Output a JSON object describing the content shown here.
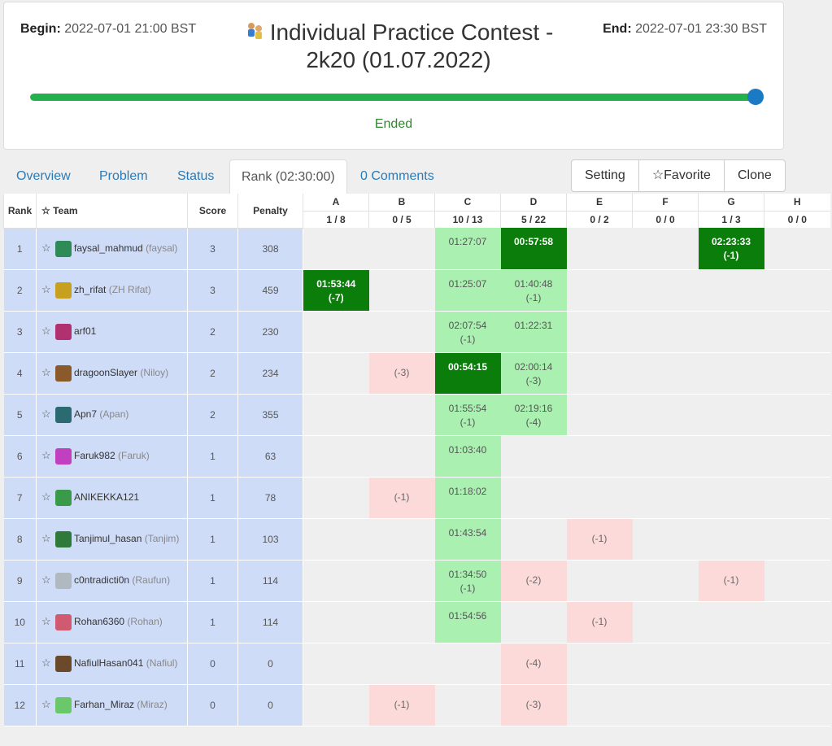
{
  "header": {
    "begin_label": "Begin:",
    "begin_value": "2022-07-01 21:00 BST",
    "end_label": "End:",
    "end_value": "2022-07-01 23:30 BST",
    "title": "Individual Practice Contest - 2k20 (01.07.2022)",
    "progress": 1.0,
    "status": "Ended"
  },
  "tabs": [
    {
      "label": "Overview"
    },
    {
      "label": "Problem"
    },
    {
      "label": "Status"
    },
    {
      "label": "Rank (02:30:00)"
    },
    {
      "label": "0 Comments"
    }
  ],
  "buttons": [
    {
      "label": "Setting"
    },
    {
      "label": "☆Favorite"
    },
    {
      "label": "Clone"
    }
  ],
  "table": {
    "col_rank": "Rank",
    "col_team": "☆ Team",
    "col_score": "Score",
    "col_penalty": "Penalty",
    "problems": [
      {
        "id": "A",
        "stat": "1 / 8"
      },
      {
        "id": "B",
        "stat": "0 / 5"
      },
      {
        "id": "C",
        "stat": "10 / 13"
      },
      {
        "id": "D",
        "stat": "5 / 22"
      },
      {
        "id": "E",
        "stat": "0 / 2"
      },
      {
        "id": "F",
        "stat": "0 / 0"
      },
      {
        "id": "G",
        "stat": "1 / 3"
      },
      {
        "id": "H",
        "stat": "0 / 0"
      }
    ],
    "rows": [
      {
        "rank": "1",
        "team": "faysal_mahmud",
        "nick": "(faysal)",
        "score": "3",
        "penalty": "308",
        "avatar_color": "#2e8b57",
        "cells": [
          {
            "s": "empty"
          },
          {
            "s": "empty"
          },
          {
            "s": "solved",
            "time": "01:27:07",
            "pen": ""
          },
          {
            "s": "first",
            "time": "00:57:58",
            "pen": ""
          },
          {
            "s": "empty"
          },
          {
            "s": "empty"
          },
          {
            "s": "first",
            "time": "02:23:33",
            "pen": "(-1)"
          },
          {
            "s": "empty"
          }
        ]
      },
      {
        "rank": "2",
        "team": "zh_rifat",
        "nick": "(ZH Rifat)",
        "score": "3",
        "penalty": "459",
        "avatar_color": "#c8a020",
        "cells": [
          {
            "s": "first",
            "time": "01:53:44",
            "pen": "(-7)"
          },
          {
            "s": "empty"
          },
          {
            "s": "solved",
            "time": "01:25:07",
            "pen": ""
          },
          {
            "s": "solved",
            "time": "01:40:48",
            "pen": "(-1)"
          },
          {
            "s": "empty"
          },
          {
            "s": "empty"
          },
          {
            "s": "empty"
          },
          {
            "s": "empty"
          }
        ]
      },
      {
        "rank": "3",
        "team": "arf01",
        "nick": "",
        "score": "2",
        "penalty": "230",
        "avatar_color": "#b03070",
        "cells": [
          {
            "s": "empty"
          },
          {
            "s": "empty"
          },
          {
            "s": "solved",
            "time": "02:07:54",
            "pen": "(-1)"
          },
          {
            "s": "solved",
            "time": "01:22:31",
            "pen": ""
          },
          {
            "s": "empty"
          },
          {
            "s": "empty"
          },
          {
            "s": "empty"
          },
          {
            "s": "empty"
          }
        ]
      },
      {
        "rank": "4",
        "team": "dragoonSlayer",
        "nick": "(Niloy)",
        "score": "2",
        "penalty": "234",
        "avatar_color": "#8b5a2b",
        "cells": [
          {
            "s": "empty"
          },
          {
            "s": "tried",
            "time": "",
            "pen": "(-3)"
          },
          {
            "s": "first",
            "time": "00:54:15",
            "pen": ""
          },
          {
            "s": "solved",
            "time": "02:00:14",
            "pen": "(-3)"
          },
          {
            "s": "empty"
          },
          {
            "s": "empty"
          },
          {
            "s": "empty"
          },
          {
            "s": "empty"
          }
        ]
      },
      {
        "rank": "5",
        "team": "Apn7",
        "nick": "(Apan)",
        "score": "2",
        "penalty": "355",
        "avatar_color": "#2a6a70",
        "cells": [
          {
            "s": "empty"
          },
          {
            "s": "empty"
          },
          {
            "s": "solved",
            "time": "01:55:54",
            "pen": "(-1)"
          },
          {
            "s": "solved",
            "time": "02:19:16",
            "pen": "(-4)"
          },
          {
            "s": "empty"
          },
          {
            "s": "empty"
          },
          {
            "s": "empty"
          },
          {
            "s": "empty"
          }
        ]
      },
      {
        "rank": "6",
        "team": "Faruk982",
        "nick": "(Faruk)",
        "score": "1",
        "penalty": "63",
        "avatar_color": "#c040c0",
        "cells": [
          {
            "s": "empty"
          },
          {
            "s": "empty"
          },
          {
            "s": "solved",
            "time": "01:03:40",
            "pen": ""
          },
          {
            "s": "empty"
          },
          {
            "s": "empty"
          },
          {
            "s": "empty"
          },
          {
            "s": "empty"
          },
          {
            "s": "empty"
          }
        ]
      },
      {
        "rank": "7",
        "team": "ANIKEKKA121",
        "nick": "",
        "score": "1",
        "penalty": "78",
        "avatar_color": "#3a9a4a",
        "cells": [
          {
            "s": "empty"
          },
          {
            "s": "tried",
            "time": "",
            "pen": "(-1)"
          },
          {
            "s": "solved",
            "time": "01:18:02",
            "pen": ""
          },
          {
            "s": "empty"
          },
          {
            "s": "empty"
          },
          {
            "s": "empty"
          },
          {
            "s": "empty"
          },
          {
            "s": "empty"
          }
        ]
      },
      {
        "rank": "8",
        "team": "Tanjimul_hasan",
        "nick": "(Tanjim)",
        "score": "1",
        "penalty": "103",
        "avatar_color": "#2f7a3a",
        "cells": [
          {
            "s": "empty"
          },
          {
            "s": "empty"
          },
          {
            "s": "solved",
            "time": "01:43:54",
            "pen": ""
          },
          {
            "s": "empty"
          },
          {
            "s": "tried",
            "time": "",
            "pen": "(-1)"
          },
          {
            "s": "empty"
          },
          {
            "s": "empty"
          },
          {
            "s": "empty"
          }
        ]
      },
      {
        "rank": "9",
        "team": "c0ntradicti0n",
        "nick": "(Raufun)",
        "score": "1",
        "penalty": "114",
        "avatar_color": "#b0b8c0",
        "cells": [
          {
            "s": "empty"
          },
          {
            "s": "empty"
          },
          {
            "s": "solved",
            "time": "01:34:50",
            "pen": "(-1)"
          },
          {
            "s": "tried",
            "time": "",
            "pen": "(-2)"
          },
          {
            "s": "empty"
          },
          {
            "s": "empty"
          },
          {
            "s": "tried",
            "time": "",
            "pen": "(-1)"
          },
          {
            "s": "empty"
          }
        ]
      },
      {
        "rank": "10",
        "team": "Rohan6360",
        "nick": "(Rohan)",
        "score": "1",
        "penalty": "114",
        "avatar_color": "#d05a70",
        "cells": [
          {
            "s": "empty"
          },
          {
            "s": "empty"
          },
          {
            "s": "solved",
            "time": "01:54:56",
            "pen": ""
          },
          {
            "s": "empty"
          },
          {
            "s": "tried",
            "time": "",
            "pen": "(-1)"
          },
          {
            "s": "empty"
          },
          {
            "s": "empty"
          },
          {
            "s": "empty"
          }
        ]
      },
      {
        "rank": "11",
        "team": "NafiulHasan041",
        "nick": "(Nafiul)",
        "score": "0",
        "penalty": "0",
        "avatar_color": "#6a4a2a",
        "cells": [
          {
            "s": "empty"
          },
          {
            "s": "empty"
          },
          {
            "s": "empty"
          },
          {
            "s": "tried",
            "time": "",
            "pen": "(-4)"
          },
          {
            "s": "empty"
          },
          {
            "s": "empty"
          },
          {
            "s": "empty"
          },
          {
            "s": "empty"
          }
        ]
      },
      {
        "rank": "12",
        "team": "Farhan_Miraz",
        "nick": "(Miraz)",
        "score": "0",
        "penalty": "0",
        "avatar_color": "#6ac86a",
        "cells": [
          {
            "s": "empty"
          },
          {
            "s": "tried",
            "time": "",
            "pen": "(-1)"
          },
          {
            "s": "empty"
          },
          {
            "s": "tried",
            "time": "",
            "pen": "(-3)"
          },
          {
            "s": "empty"
          },
          {
            "s": "empty"
          },
          {
            "s": "empty"
          },
          {
            "s": "empty"
          }
        ]
      }
    ]
  }
}
